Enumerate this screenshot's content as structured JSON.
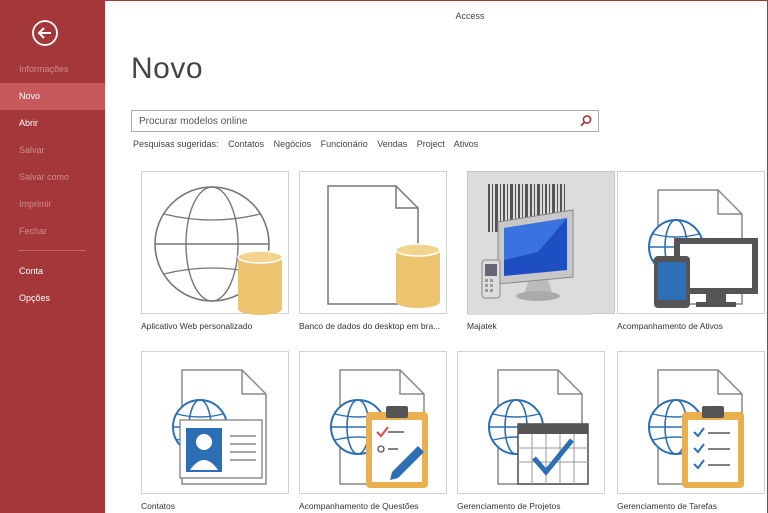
{
  "window": {
    "app_title": "Access"
  },
  "sidebar": {
    "items": [
      {
        "label": "Informações",
        "state": "disabled"
      },
      {
        "label": "Novo",
        "state": "active"
      },
      {
        "label": "Abrir",
        "state": "enabled"
      },
      {
        "label": "Salvar",
        "state": "disabled"
      },
      {
        "label": "Salvar como",
        "state": "disabled"
      },
      {
        "label": "Imprimir",
        "state": "disabled"
      },
      {
        "label": "Fechar",
        "state": "disabled"
      },
      {
        "label": "Conta",
        "state": "enabled"
      },
      {
        "label": "Opções",
        "state": "enabled"
      }
    ]
  },
  "main": {
    "title": "Novo",
    "search": {
      "placeholder": "Procurar modelos online",
      "value": ""
    },
    "suggested": {
      "label": "Pesquisas sugeridas:",
      "links": [
        "Contatos",
        "Negócios",
        "Funcionário",
        "Vendas",
        "Project",
        "Ativos"
      ]
    },
    "templates": [
      {
        "label": "Aplicativo Web personalizado",
        "icon": "globe-database-icon"
      },
      {
        "label": "Banco de dados do desktop em bra...",
        "icon": "document-database-icon"
      },
      {
        "label": "Majatek",
        "icon": "barcode-monitor-icon",
        "selected": true
      },
      {
        "label": "Acompanhamento de Ativos",
        "icon": "globe-devices-icon"
      },
      {
        "label": "Contatos",
        "icon": "globe-contact-card-icon"
      },
      {
        "label": "Acompanhamento de Questões",
        "icon": "globe-clipboard-pen-icon"
      },
      {
        "label": "Gerenciamento de Projetos",
        "icon": "globe-calendar-check-icon"
      },
      {
        "label": "Gerenciamento de Tarefas",
        "icon": "globe-clipboard-checklist-icon"
      }
    ]
  },
  "colors": {
    "sidebar_bg": "#a4373a",
    "sidebar_active": "#c5595c",
    "sidebar_disabled_text": "#cf8c8d",
    "database_gold": "#ecc36e",
    "clipboard_orange": "#eab04f",
    "check_blue": "#2d6bb3"
  }
}
